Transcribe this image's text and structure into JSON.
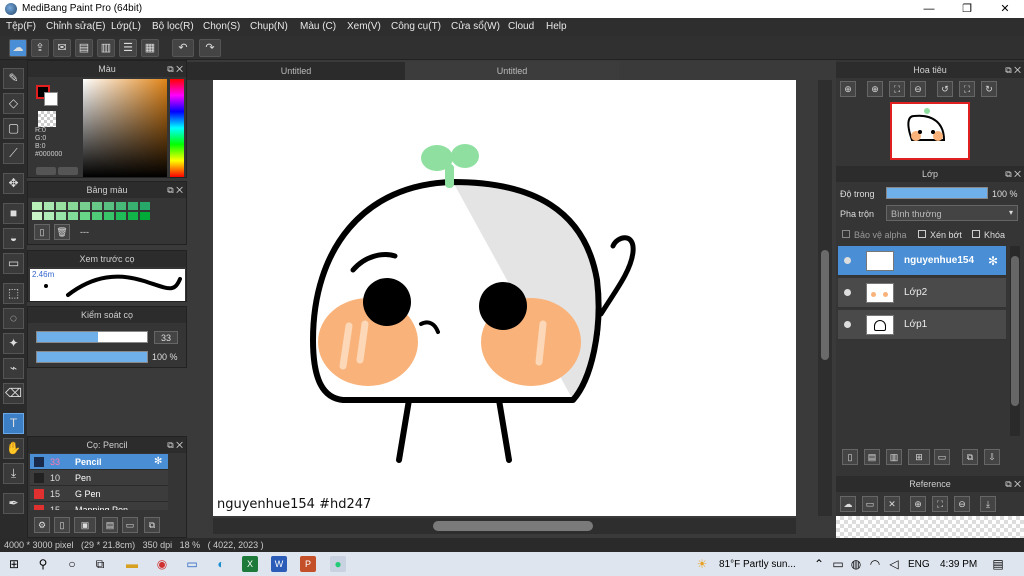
{
  "window": {
    "title": "MediBang Paint Pro (64bit)",
    "minimize": "—",
    "restore": "❐",
    "close": "✕"
  },
  "menu": [
    "Tệp(F)",
    "Chỉnh sửa(E)",
    "Lớp(L)",
    "Bộ lọc(R)",
    "Chọn(S)",
    "Chụp(N)",
    "Màu (C)",
    "Xem(V)",
    "Công cụ(T)",
    "Cửa sổ(W)",
    "Cloud",
    "Help"
  ],
  "documents": {
    "tab1": "Untitled",
    "tab2": "Untitled"
  },
  "color_panel": {
    "title": "Màu",
    "r": "R:0",
    "g": "G:0",
    "b": "B:0",
    "hex": "#000000"
  },
  "palette_panel": {
    "title": "Bảng màu",
    "label": "---"
  },
  "brush_preview": {
    "title": "Xem trước cọ",
    "size": "2.46m"
  },
  "brush_control": {
    "title": "Kiểm soát cọ",
    "size_value": "33",
    "opacity_value": "100 %",
    "size_fraction": 0.55,
    "opacity_fraction": 1.0
  },
  "brush_panel": {
    "title": "Cọ: Pencil",
    "items": [
      {
        "size": "33",
        "name": "Pencil",
        "color": "#1a2a4a"
      },
      {
        "size": "10",
        "name": "Pen",
        "color": "#222222"
      },
      {
        "size": "15",
        "name": "G Pen",
        "color": "#e03030"
      },
      {
        "size": "15",
        "name": "Mapping Pen",
        "color": "#e03030"
      }
    ]
  },
  "canvas_caption": "nguyenhue154 #hd247",
  "navigator": {
    "title": "Hoa tiêu"
  },
  "layers_panel": {
    "title": "Lớp",
    "opacity_label": "Độ trong",
    "opacity_value": "100 %",
    "opacity_fraction": 1.0,
    "blend_label": "Pha trộn",
    "blend_value": "Bình thường",
    "protect_alpha": "Bảo vệ alpha",
    "clipping": "Xén bớt",
    "lock": "Khóa",
    "layers": [
      {
        "name": "nguyenhue154"
      },
      {
        "name": "Lớp2"
      },
      {
        "name": "Lớp1"
      }
    ]
  },
  "reference_panel": {
    "title": "Reference"
  },
  "status": "4000 * 3000 pixel   (29 * 21.8cm)   350 dpi   18 %   ( 4022, 2023 )",
  "taskbar": {
    "weather": "81°F  Partly sun...",
    "lang": "ENG",
    "time": "4:39 PM"
  },
  "colors": {
    "accent": "#4a8fd6",
    "blush": "#f9b37a",
    "sprout": "#8fe0a0"
  },
  "icons": {
    "undo": "undo-icon",
    "redo": "redo-icon",
    "cloud": "cloud-icon",
    "brush": "brush-icon",
    "eraser": "eraser-icon",
    "text": "text-icon"
  }
}
